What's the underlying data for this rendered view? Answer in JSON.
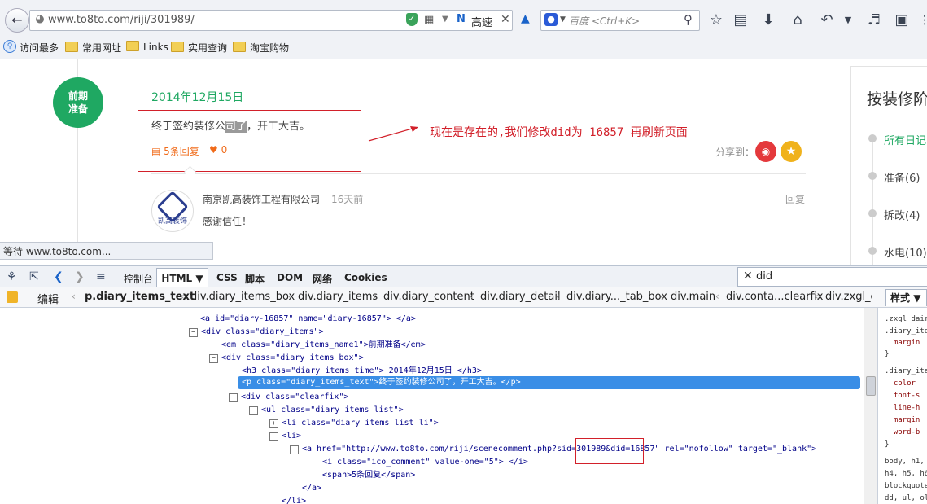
{
  "browser": {
    "url": "www.to8to.com/riji/301989/",
    "fast_label": "高速",
    "search_placeholder": "百度 <Ctrl+K>",
    "bookmarks": [
      "访问最多",
      "常用网址",
      "Links",
      "实用查询",
      "淘宝购物"
    ]
  },
  "page": {
    "stage_badge": "前期\n准备",
    "diary_date": "2014年12月15日",
    "diary_text_a": "终于签约装修公",
    "diary_text_hl": "司了",
    "diary_text_b": "，开工大吉。",
    "reply_count": "5条回复",
    "like_count": "0",
    "share_label": "分享到：",
    "annotation": "现在是存在的,我们修改did为 16857 再刷新页面",
    "comment": {
      "avatar_label": "凯高装饰",
      "company": "南京凯高装饰工程有限公司",
      "time": "16天前",
      "reply": "回复",
      "text": "感谢信任！"
    },
    "sidebar": {
      "title": "按装修阶",
      "items": [
        {
          "label": "所有日记",
          "active": true
        },
        {
          "label": "准备(6)",
          "active": false
        },
        {
          "label": "拆改(4)",
          "active": false
        },
        {
          "label": "水电(10)",
          "active": false
        }
      ]
    }
  },
  "status_text": "等待 www.to8to.com...",
  "firebug": {
    "tabs": [
      "控制台",
      "HTML",
      "CSS",
      "脚本",
      "DOM",
      "网络",
      "Cookies"
    ],
    "search_value": "did",
    "edit_label": "编辑",
    "style_tab": "样式",
    "breadcrumbs": [
      "p.diary_items_text",
      "div.diary_items_box",
      "div.diary_items",
      "div.diary_content",
      "div.diary_detail",
      "div.diary..._tab_box",
      "div.main",
      "div.conta...clearfix",
      "div.zxgl_c"
    ],
    "tree": {
      "anchor": "<a id=\"diary-16857\" name=\"diary-16857\"> </a>",
      "div_items": "<div class=\"diary_items\">",
      "em_name": "<em class=\"diary_items_name1\">前期准备</em>",
      "div_box": "<div class=\"diary_items_box\">",
      "h3_time": "<h3 class=\"diary_items_time\"> 2014年12月15日 </h3>",
      "p_text": "<p class=\"diary_items_text\">终于签约装修公司了，开工大吉。</p>",
      "div_clearfix": "<div class=\"clearfix\">",
      "ul_list": "<ul class=\"diary_items_list\">",
      "li_list": "<li class=\"diary_items_list_li\">",
      "li": "<li>",
      "a_href": "<a href=\"http://www.to8to.com/riji/scenecomment.php?sid=301989&did=16857\" rel=\"nofollow\" target=\"_blank\">",
      "i_comment": "<i class=\"ico_comment\" value-one=\"5\"> </i>",
      "span_reply": "<span>5条回复</span>",
      "a_close": "</a>",
      "li_close": "</li>"
    },
    "css_lines": [
      ".zxgl_dair",
      ".diary_ite",
      "  margin",
      "}",
      "",
      ".diary_ite",
      "  color",
      "  font-s",
      "  line-h",
      "  margin",
      "  word-b",
      "}",
      "body, h1,",
      "h4, h5, h6",
      "blockquote",
      "dd, ul, ol"
    ]
  }
}
